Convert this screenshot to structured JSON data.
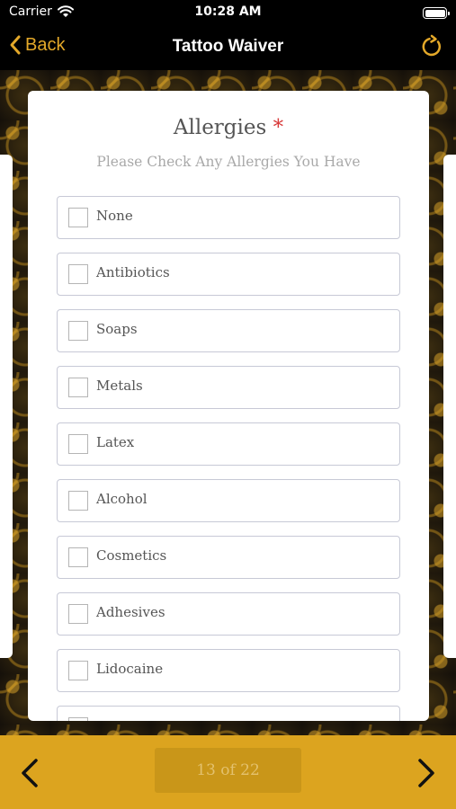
{
  "status_bar": {
    "carrier": "Carrier",
    "time": "10:28 AM"
  },
  "nav": {
    "back_label": "Back",
    "title": "Tattoo Waiver"
  },
  "question": {
    "title": "Allergies",
    "required_marker": "*",
    "subtitle": "Please Check Any Allergies You Have",
    "options": [
      {
        "label": "None",
        "checked": false
      },
      {
        "label": "Antibiotics",
        "checked": false
      },
      {
        "label": "Soaps",
        "checked": false
      },
      {
        "label": "Metals",
        "checked": false
      },
      {
        "label": "Latex",
        "checked": false
      },
      {
        "label": "Alcohol",
        "checked": false
      },
      {
        "label": "Cosmetics",
        "checked": false
      },
      {
        "label": "Adhesives",
        "checked": false
      },
      {
        "label": "Lidocaine",
        "checked": false
      },
      {
        "label": "",
        "checked": false
      }
    ]
  },
  "pagination": {
    "indicator": "13 of 22"
  },
  "colors": {
    "accent": "#e3a829",
    "bottom_bar": "#dca41f",
    "required": "#d83a3a"
  }
}
